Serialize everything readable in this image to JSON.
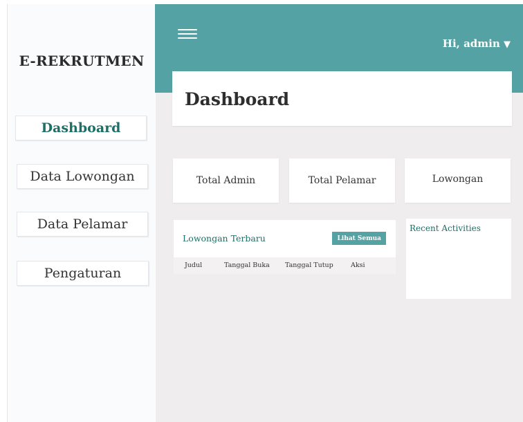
{
  "app": {
    "brand": "E-REKRUTMEN"
  },
  "sidebar": {
    "items": [
      {
        "label": "Dashboard",
        "active": true
      },
      {
        "label": "Data Lowongan",
        "active": false
      },
      {
        "label": "Data Pelamar",
        "active": false
      },
      {
        "label": "Pengaturan",
        "active": false
      }
    ]
  },
  "header": {
    "menu_icon": "hamburger-icon",
    "user_label": "Hi, admin",
    "user_caret": "▼"
  },
  "page": {
    "title": "Dashboard"
  },
  "stats": [
    {
      "label": "Total Admin"
    },
    {
      "label": "Total Pelamar"
    },
    {
      "label": "Lowongan"
    }
  ],
  "latest_jobs": {
    "title": "Lowongan Terbaru",
    "button_label": "Lihat Semua",
    "columns": [
      "Judul",
      "Tanggal Buka",
      "Tanggal Tutup",
      "Aksi"
    ]
  },
  "recent_activities": {
    "title": "Recent Activities"
  },
  "colors": {
    "accent": "#55a2a4",
    "accent_text": "#1e6f66",
    "background": "#f0edee"
  }
}
